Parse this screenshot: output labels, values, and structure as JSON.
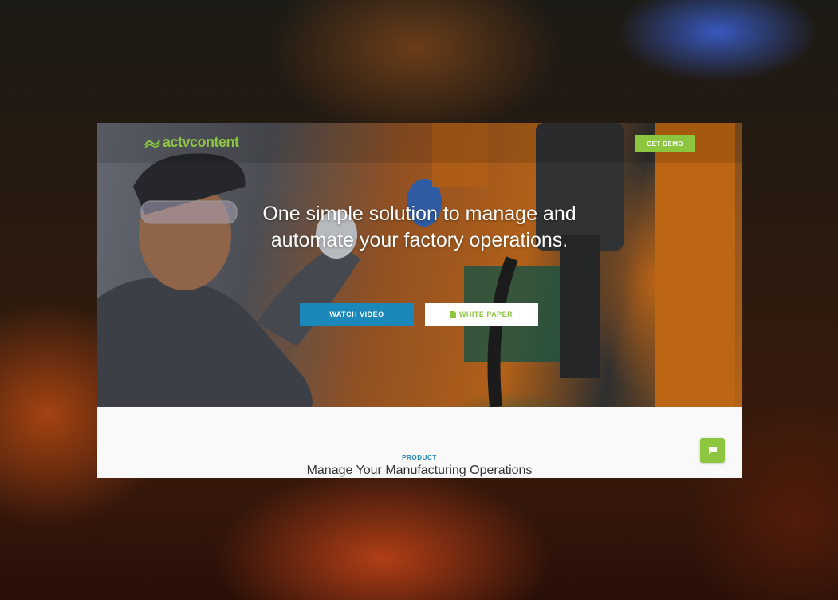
{
  "brand": {
    "logo_text": "actvcontent",
    "accent_color": "#8cc63f",
    "secondary_color": "#1a88b8"
  },
  "header": {
    "demo_button_label": "GET DEMO"
  },
  "hero": {
    "headline_line1": "One simple solution to manage and",
    "headline_line2": "automate your factory operations.",
    "watch_video_label": "WATCH VIDEO",
    "white_paper_label": "WHITE PAPER",
    "white_paper_icon": "document-icon"
  },
  "section": {
    "eyebrow": "PRODUCT",
    "title": "Manage Your Manufacturing Operations"
  },
  "chat": {
    "icon": "chat-bubble-icon"
  }
}
